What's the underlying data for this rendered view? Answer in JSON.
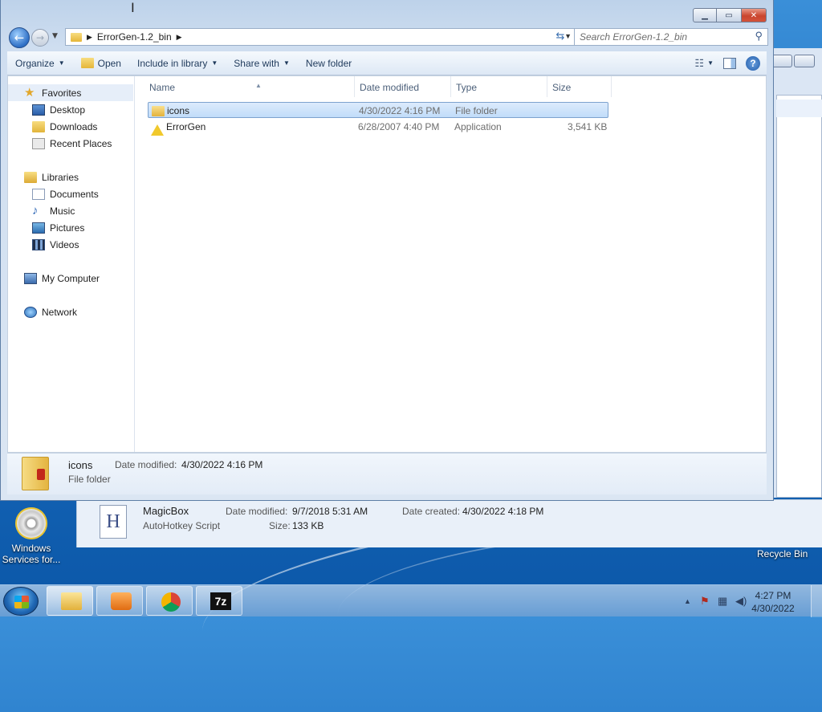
{
  "window": {
    "breadcrumb": [
      "ErrorGen-1.2_bin"
    ],
    "search_placeholder": "Search ErrorGen-1.2_bin",
    "caption": {
      "minimize": "▭",
      "maximize": "▣",
      "close": "✕"
    }
  },
  "toolbar": {
    "organize": "Organize",
    "open": "Open",
    "include_in_library": "Include in library",
    "share_with": "Share with",
    "new_folder": "New folder"
  },
  "nav": {
    "favorites": "Favorites",
    "desktop": "Desktop",
    "downloads": "Downloads",
    "recent_places": "Recent Places",
    "libraries": "Libraries",
    "documents": "Documents",
    "music": "Music",
    "pictures": "Pictures",
    "videos": "Videos",
    "my_computer": "My Computer",
    "network": "Network"
  },
  "columns": {
    "name": "Name",
    "date_modified": "Date modified",
    "type": "Type",
    "size": "Size"
  },
  "files": [
    {
      "name": "icons",
      "date": "4/30/2022 4:16 PM",
      "type": "File folder",
      "size": "",
      "icon": "folder-icon"
    },
    {
      "name": "ErrorGen",
      "date": "6/28/2007 4:40 PM",
      "type": "Application",
      "size": "3,541 KB",
      "icon": "warning-icon"
    }
  ],
  "details": {
    "name": "icons",
    "date_label": "Date modified:",
    "date_value": "4/30/2022 4:16 PM",
    "type": "File folder"
  },
  "bg_details": {
    "name": "MagicBox",
    "date_mod_label": "Date modified:",
    "date_mod_value": "9/7/2018 5:31 AM",
    "date_created_label": "Date created:",
    "date_created_value": "4/30/2022 4:18 PM",
    "type": "AutoHotkey Script",
    "size_label": "Size:",
    "size_value": "133 KB",
    "icon_letter": "H"
  },
  "desktop": {
    "icon_label_1": "Windows",
    "icon_label_2": "Services for...",
    "recycle_bin": "Recycle Bin"
  },
  "taskbar": {
    "time": "4:27 PM",
    "date": "4/30/2022",
    "app_7z": "7z"
  }
}
